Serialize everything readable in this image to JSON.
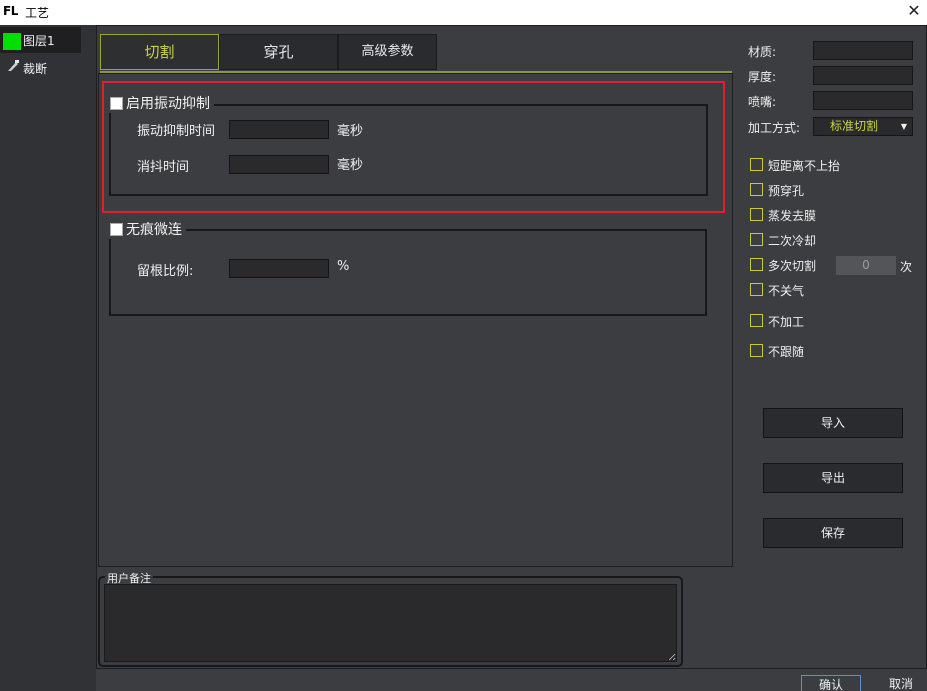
{
  "window": {
    "logo": "FL",
    "title": "工艺",
    "close_glyph": "✕"
  },
  "layers": [
    {
      "label": "图层1",
      "color": "#00e000",
      "active": true
    },
    {
      "label": "裁断",
      "icon": "cut-icon",
      "active": false
    }
  ],
  "tabs": [
    {
      "label": "切割",
      "active": true
    },
    {
      "label": "穿孔",
      "active": false
    },
    {
      "label": "高级参数",
      "active": false
    }
  ],
  "vibration": {
    "title": "启用振动抑制",
    "checked": false,
    "rows": [
      {
        "label": "振动抑制时间",
        "value": "",
        "unit": "毫秒"
      },
      {
        "label": "消抖时间",
        "value": "",
        "unit": "毫秒"
      }
    ]
  },
  "seamless": {
    "title": "无痕微连",
    "checked": false,
    "rows": [
      {
        "label": "留根比例:",
        "value": "",
        "unit": "%"
      }
    ]
  },
  "notes": {
    "label": "用户备注",
    "value": ""
  },
  "properties": {
    "material_label": "材质:",
    "material_value": "",
    "thickness_label": "厚度:",
    "thickness_value": "",
    "nozzle_label": "喷嘴:",
    "nozzle_value": "",
    "mode_label": "加工方式:",
    "mode_value": "标准切割",
    "mode_arrow": "▼"
  },
  "options": [
    {
      "label": "短距离不上抬",
      "checked": false
    },
    {
      "label": "预穿孔",
      "checked": false
    },
    {
      "label": "蒸发去膜",
      "checked": false
    },
    {
      "label": "二次冷却",
      "checked": false
    },
    {
      "label": "多次切割",
      "checked": false
    },
    {
      "label": "不关气",
      "checked": false
    },
    {
      "label": "不加工",
      "checked": false
    },
    {
      "label": "不跟随",
      "checked": false
    }
  ],
  "multi_cut": {
    "value": "0",
    "unit": "次"
  },
  "side_buttons": {
    "import": "导入",
    "export": "导出",
    "save": "保存"
  },
  "footer": {
    "ok": "确认",
    "cancel": "取消"
  },
  "colors": {
    "accent": "#c9d24a",
    "highlight": "#e0202a",
    "layer_green": "#00e000"
  }
}
